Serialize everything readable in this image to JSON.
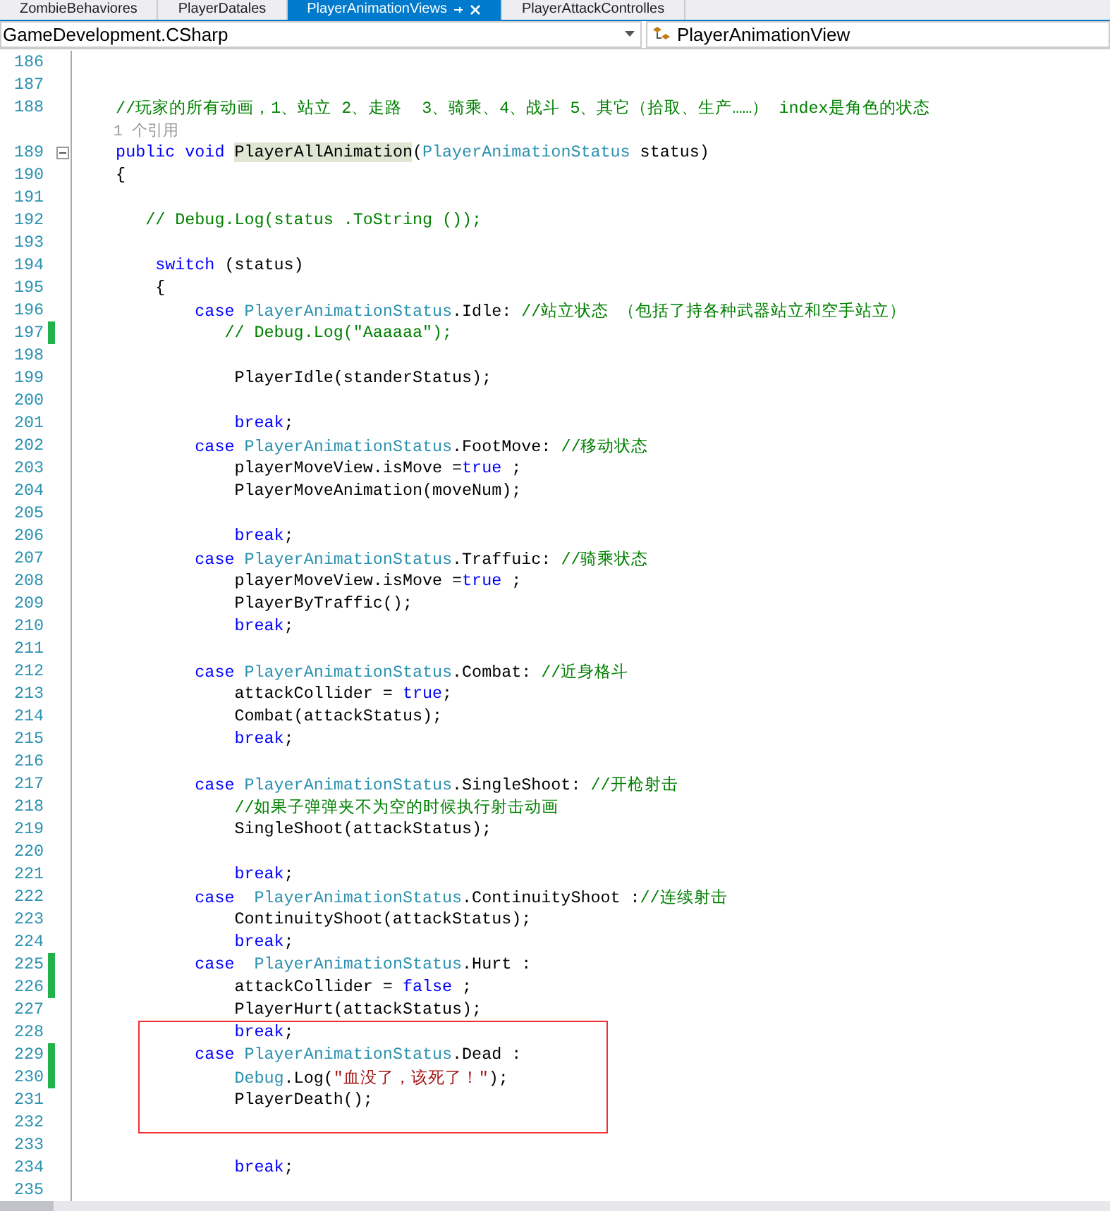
{
  "tabs": [
    {
      "label": "ZombieBehaviores",
      "selected": false
    },
    {
      "label": "PlayerDatales",
      "selected": false
    },
    {
      "label": "PlayerAnimationViews",
      "selected": true
    },
    {
      "label": "PlayerAttackControlles",
      "selected": false
    }
  ],
  "navigation": {
    "project_dropdown": "GameDevelopment.CSharp",
    "member_dropdown": "PlayerAnimationView"
  },
  "code": {
    "lines": [
      {
        "kind": "code",
        "number": "186",
        "changed": false
      },
      {
        "kind": "code",
        "number": "187",
        "changed": false
      },
      {
        "kind": "code",
        "number": "188",
        "changed": false,
        "tokens": [
          {
            "kind": "comment",
            "text": "    //玩家的所有动画，1、站立 2、走路  3、骑乘、4、战斗 5、其它（拾取、生产……） index是角色的状态"
          }
        ]
      },
      {
        "kind": "codelens",
        "text": "1 个引用"
      },
      {
        "kind": "code",
        "number": "189",
        "changed": false,
        "collapsible": true,
        "tokens": [
          {
            "kind": "keyword",
            "text": "    public"
          },
          {
            "kind": "keyword",
            "text": " void "
          },
          {
            "kind": "highlight",
            "text": "PlayerAllAnimation"
          },
          {
            "kind": "plain",
            "text": "("
          },
          {
            "kind": "type",
            "text": "PlayerAnimationStatus"
          },
          {
            "kind": "plain",
            "text": " status)"
          }
        ]
      },
      {
        "kind": "code",
        "number": "190",
        "changed": false,
        "tokens": [
          {
            "kind": "plain",
            "text": "    {"
          }
        ]
      },
      {
        "kind": "code",
        "number": "191",
        "changed": false
      },
      {
        "kind": "code",
        "number": "192",
        "changed": false,
        "tokens": [
          {
            "kind": "comment",
            "text": "       // Debug.Log(status .ToString ());"
          }
        ]
      },
      {
        "kind": "code",
        "number": "193",
        "changed": false
      },
      {
        "kind": "code",
        "number": "194",
        "changed": false,
        "tokens": [
          {
            "kind": "keyword",
            "text": "        switch"
          },
          {
            "kind": "plain",
            "text": " (status)"
          }
        ]
      },
      {
        "kind": "code",
        "number": "195",
        "changed": false,
        "tokens": [
          {
            "kind": "plain",
            "text": "        {"
          }
        ]
      },
      {
        "kind": "code",
        "number": "196",
        "changed": false,
        "tokens": [
          {
            "kind": "keyword",
            "text": "            case "
          },
          {
            "kind": "type",
            "text": "PlayerAnimationStatus"
          },
          {
            "kind": "plain",
            "text": ".Idle: "
          },
          {
            "kind": "comment",
            "text": "//站立状态 （包括了持各种武器站立和空手站立）"
          }
        ]
      },
      {
        "kind": "code",
        "number": "197",
        "changed": true,
        "tokens": [
          {
            "kind": "comment",
            "text": "               // Debug.Log(\"Aaaaaa\");"
          }
        ]
      },
      {
        "kind": "code",
        "number": "198",
        "changed": false
      },
      {
        "kind": "code",
        "number": "199",
        "changed": false,
        "tokens": [
          {
            "kind": "plain",
            "text": "                PlayerIdle(standerStatus);"
          }
        ]
      },
      {
        "kind": "code",
        "number": "200",
        "changed": false
      },
      {
        "kind": "code",
        "number": "201",
        "changed": false,
        "tokens": [
          {
            "kind": "keyword",
            "text": "                break"
          },
          {
            "kind": "plain",
            "text": ";"
          }
        ]
      },
      {
        "kind": "code",
        "number": "202",
        "changed": false,
        "tokens": [
          {
            "kind": "keyword",
            "text": "            case "
          },
          {
            "kind": "type",
            "text": "PlayerAnimationStatus"
          },
          {
            "kind": "plain",
            "text": ".FootMove: "
          },
          {
            "kind": "comment",
            "text": "//移动状态"
          }
        ]
      },
      {
        "kind": "code",
        "number": "203",
        "changed": false,
        "tokens": [
          {
            "kind": "plain",
            "text": "                playerMoveView.isMove ="
          },
          {
            "kind": "keyword",
            "text": "true"
          },
          {
            "kind": "plain",
            "text": " ;"
          }
        ]
      },
      {
        "kind": "code",
        "number": "204",
        "changed": false,
        "tokens": [
          {
            "kind": "plain",
            "text": "                PlayerMoveAnimation(moveNum);"
          }
        ]
      },
      {
        "kind": "code",
        "number": "205",
        "changed": false
      },
      {
        "kind": "code",
        "number": "206",
        "changed": false,
        "tokens": [
          {
            "kind": "keyword",
            "text": "                break"
          },
          {
            "kind": "plain",
            "text": ";"
          }
        ]
      },
      {
        "kind": "code",
        "number": "207",
        "changed": false,
        "tokens": [
          {
            "kind": "keyword",
            "text": "            case "
          },
          {
            "kind": "type",
            "text": "PlayerAnimationStatus"
          },
          {
            "kind": "plain",
            "text": ".Traffuic: "
          },
          {
            "kind": "comment",
            "text": "//骑乘状态"
          }
        ]
      },
      {
        "kind": "code",
        "number": "208",
        "changed": false,
        "tokens": [
          {
            "kind": "plain",
            "text": "                playerMoveView.isMove ="
          },
          {
            "kind": "keyword",
            "text": "true"
          },
          {
            "kind": "plain",
            "text": " ;"
          }
        ]
      },
      {
        "kind": "code",
        "number": "209",
        "changed": false,
        "tokens": [
          {
            "kind": "plain",
            "text": "                PlayerByTraffic();"
          }
        ]
      },
      {
        "kind": "code",
        "number": "210",
        "changed": false,
        "tokens": [
          {
            "kind": "keyword",
            "text": "                break"
          },
          {
            "kind": "plain",
            "text": ";"
          }
        ]
      },
      {
        "kind": "code",
        "number": "211",
        "changed": false
      },
      {
        "kind": "code",
        "number": "212",
        "changed": false,
        "tokens": [
          {
            "kind": "keyword",
            "text": "            case "
          },
          {
            "kind": "type",
            "text": "PlayerAnimationStatus"
          },
          {
            "kind": "plain",
            "text": ".Combat: "
          },
          {
            "kind": "comment",
            "text": "//近身格斗"
          }
        ]
      },
      {
        "kind": "code",
        "number": "213",
        "changed": false,
        "tokens": [
          {
            "kind": "plain",
            "text": "                attackCollider = "
          },
          {
            "kind": "keyword",
            "text": "true"
          },
          {
            "kind": "plain",
            "text": ";"
          }
        ]
      },
      {
        "kind": "code",
        "number": "214",
        "changed": false,
        "tokens": [
          {
            "kind": "plain",
            "text": "                Combat(attackStatus);"
          }
        ]
      },
      {
        "kind": "code",
        "number": "215",
        "changed": false,
        "tokens": [
          {
            "kind": "keyword",
            "text": "                break"
          },
          {
            "kind": "plain",
            "text": ";"
          }
        ]
      },
      {
        "kind": "code",
        "number": "216",
        "changed": false
      },
      {
        "kind": "code",
        "number": "217",
        "changed": false,
        "tokens": [
          {
            "kind": "keyword",
            "text": "            case "
          },
          {
            "kind": "type",
            "text": "PlayerAnimationStatus"
          },
          {
            "kind": "plain",
            "text": ".SingleShoot: "
          },
          {
            "kind": "comment",
            "text": "//开枪射击"
          }
        ]
      },
      {
        "kind": "code",
        "number": "218",
        "changed": false,
        "tokens": [
          {
            "kind": "comment",
            "text": "                //如果子弹弹夹不为空的时候执行射击动画"
          }
        ]
      },
      {
        "kind": "code",
        "number": "219",
        "changed": false,
        "tokens": [
          {
            "kind": "plain",
            "text": "                SingleShoot(attackStatus);"
          }
        ]
      },
      {
        "kind": "code",
        "number": "220",
        "changed": false
      },
      {
        "kind": "code",
        "number": "221",
        "changed": false,
        "tokens": [
          {
            "kind": "keyword",
            "text": "                break"
          },
          {
            "kind": "plain",
            "text": ";"
          }
        ]
      },
      {
        "kind": "code",
        "number": "222",
        "changed": false,
        "tokens": [
          {
            "kind": "keyword",
            "text": "            case  "
          },
          {
            "kind": "type",
            "text": "PlayerAnimationStatus"
          },
          {
            "kind": "plain",
            "text": ".ContinuityShoot :"
          },
          {
            "kind": "comment",
            "text": "//连续射击"
          }
        ]
      },
      {
        "kind": "code",
        "number": "223",
        "changed": false,
        "tokens": [
          {
            "kind": "plain",
            "text": "                ContinuityShoot(attackStatus);"
          }
        ]
      },
      {
        "kind": "code",
        "number": "224",
        "changed": false,
        "tokens": [
          {
            "kind": "keyword",
            "text": "                break"
          },
          {
            "kind": "plain",
            "text": ";"
          }
        ]
      },
      {
        "kind": "code",
        "number": "225",
        "changed": true,
        "tokens": [
          {
            "kind": "keyword",
            "text": "            case  "
          },
          {
            "kind": "type",
            "text": "PlayerAnimationStatus"
          },
          {
            "kind": "plain",
            "text": ".Hurt :"
          }
        ]
      },
      {
        "kind": "code",
        "number": "226",
        "changed": true,
        "tokens": [
          {
            "kind": "plain",
            "text": "                attackCollider = "
          },
          {
            "kind": "keyword",
            "text": "false"
          },
          {
            "kind": "plain",
            "text": " ;"
          }
        ]
      },
      {
        "kind": "code",
        "number": "227",
        "changed": false,
        "tokens": [
          {
            "kind": "plain",
            "text": "                PlayerHurt(attackStatus);"
          }
        ]
      },
      {
        "kind": "code",
        "number": "228",
        "changed": false,
        "boxed": true,
        "tokens": [
          {
            "kind": "keyword",
            "text": "                break"
          },
          {
            "kind": "plain",
            "text": ";"
          }
        ]
      },
      {
        "kind": "code",
        "number": "229",
        "changed": true,
        "boxed": true,
        "tokens": [
          {
            "kind": "keyword",
            "text": "            case "
          },
          {
            "kind": "type",
            "text": "PlayerAnimationStatus"
          },
          {
            "kind": "plain",
            "text": ".Dead :"
          }
        ]
      },
      {
        "kind": "code",
        "number": "230",
        "changed": true,
        "boxed": true,
        "tokens": [
          {
            "kind": "type",
            "text": "                Debug"
          },
          {
            "kind": "plain",
            "text": ".Log("
          },
          {
            "kind": "string",
            "text": "\"血没了，该死了！\""
          },
          {
            "kind": "plain",
            "text": ");"
          }
        ]
      },
      {
        "kind": "code",
        "number": "231",
        "changed": false,
        "boxed": true,
        "tokens": [
          {
            "kind": "plain",
            "text": "                PlayerDeath();"
          }
        ]
      },
      {
        "kind": "code",
        "number": "232",
        "changed": false,
        "boxed": true
      },
      {
        "kind": "code",
        "number": "233",
        "changed": false
      },
      {
        "kind": "code",
        "number": "234",
        "changed": false,
        "tokens": [
          {
            "kind": "keyword",
            "text": "                break"
          },
          {
            "kind": "plain",
            "text": ";"
          }
        ]
      },
      {
        "kind": "code",
        "number": "235",
        "changed": false
      }
    ]
  }
}
